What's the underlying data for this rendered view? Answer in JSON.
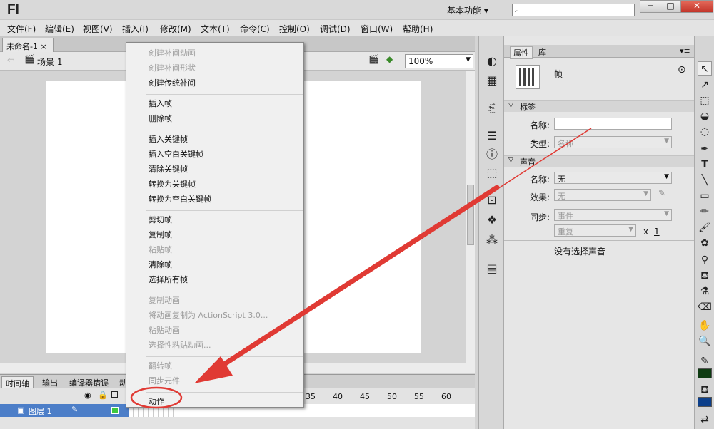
{
  "app": {
    "logo": "Fl",
    "workspace": "基本功能",
    "window_buttons": [
      "─",
      "□",
      "✕"
    ]
  },
  "menu": [
    "文件(F)",
    "编辑(E)",
    "视图(V)",
    "插入(I)",
    "修改(M)",
    "文本(T)",
    "命令(C)",
    "控制(O)",
    "调试(D)",
    "窗口(W)",
    "帮助(H)"
  ],
  "document": {
    "tab_label": "未命名-1",
    "scene": "场景 1",
    "zoom": "100%"
  },
  "timeline": {
    "tabs": [
      "时间轴",
      "输出",
      "编译器错误",
      "动"
    ],
    "frame_numbers": [
      "35",
      "40",
      "45",
      "50",
      "55",
      "60"
    ],
    "layer_name": "图层 1"
  },
  "context_menu": {
    "groups": [
      [
        {
          "label": "创建补间动画",
          "enabled": false
        },
        {
          "label": "创建补间形状",
          "enabled": false
        },
        {
          "label": "创建传统补间",
          "enabled": true
        }
      ],
      [
        {
          "label": "插入帧",
          "enabled": true
        },
        {
          "label": "删除帧",
          "enabled": true
        }
      ],
      [
        {
          "label": "插入关键帧",
          "enabled": true
        },
        {
          "label": "插入空白关键帧",
          "enabled": true
        },
        {
          "label": "清除关键帧",
          "enabled": true
        },
        {
          "label": "转换为关键帧",
          "enabled": true
        },
        {
          "label": "转换为空白关键帧",
          "enabled": true
        }
      ],
      [
        {
          "label": "剪切帧",
          "enabled": true
        },
        {
          "label": "复制帧",
          "enabled": true
        },
        {
          "label": "粘贴帧",
          "enabled": false
        },
        {
          "label": "清除帧",
          "enabled": true
        },
        {
          "label": "选择所有帧",
          "enabled": true
        }
      ],
      [
        {
          "label": "复制动画",
          "enabled": false
        },
        {
          "label": "将动画复制为 ActionScript 3.0...",
          "enabled": false
        },
        {
          "label": "粘贴动画",
          "enabled": false
        },
        {
          "label": "选择性粘贴动画...",
          "enabled": false
        }
      ],
      [
        {
          "label": "翻转帧",
          "enabled": false
        },
        {
          "label": "同步元件",
          "enabled": false
        }
      ],
      [
        {
          "label": "动作",
          "enabled": true
        }
      ]
    ]
  },
  "properties": {
    "tabs": [
      "属性",
      "库"
    ],
    "type_label": "帧",
    "label_section": "标签",
    "name_label": "名称:",
    "name_value": "",
    "type_field_label": "类型:",
    "type_value": "名称",
    "sound_section": "声音",
    "sound_name_label": "名称:",
    "sound_name_value": "无",
    "effect_label": "效果:",
    "effect_value": "无",
    "sync_label": "同步:",
    "sync_value": "事件",
    "repeat_value": "重复",
    "repeat_x": "x",
    "repeat_count": "1",
    "no_sound": "没有选择声音"
  },
  "colors": {
    "annotation": "#e03a34",
    "layer_highlight": "#4c7ec8",
    "stroke_color": "#0e3b12",
    "fill_color": "#0c3f8a"
  }
}
